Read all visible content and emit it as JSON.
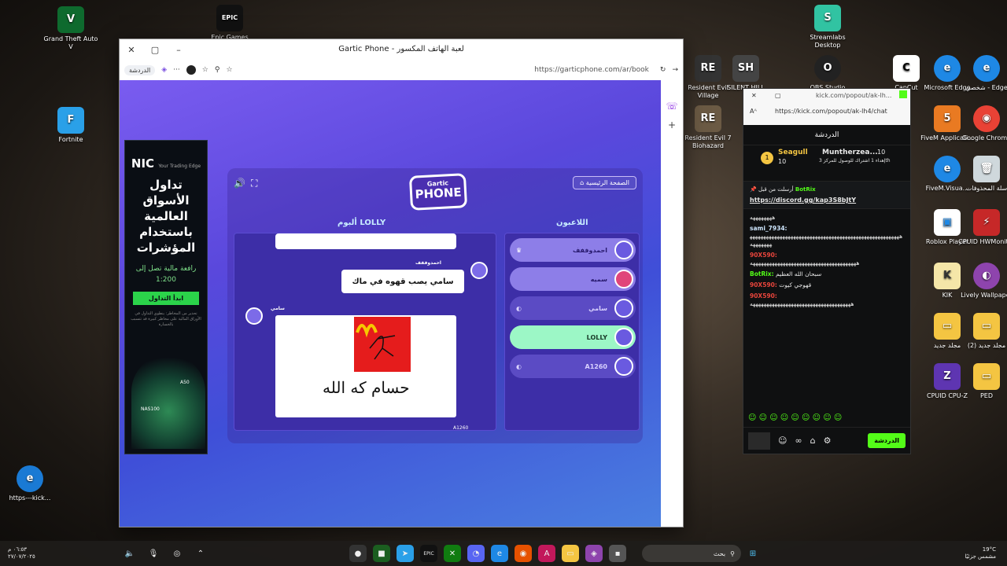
{
  "desktop": {
    "left_icons": [
      {
        "label": "Grand Theft Auto V",
        "glyph": "V"
      },
      {
        "label": "Epic Games",
        "glyph": "EPIC"
      },
      {
        "label": "Fortnite",
        "glyph": "F"
      },
      {
        "label": "https---kick...",
        "glyph": "e"
      }
    ],
    "right_icons": [
      {
        "label": "Streamlabs Desktop",
        "glyph": "S"
      },
      {
        "label": "Resident Evil Village",
        "glyph": "RE"
      },
      {
        "label": "SILENT HILL",
        "glyph": "SH"
      },
      {
        "label": "OBS Studio",
        "glyph": "O"
      },
      {
        "label": "CapCut",
        "glyph": "C"
      },
      {
        "label": "Microsoft Edge",
        "glyph": "e"
      },
      {
        "label": "شخصي - Edge",
        "glyph": "e"
      },
      {
        "label": "Resident Evil 7 Biohazard",
        "glyph": "RE"
      },
      {
        "label": "FiveM Applicati...",
        "glyph": "5"
      },
      {
        "label": "Google Chrome",
        "glyph": "◉"
      },
      {
        "label": "FiveM.Visua...",
        "glyph": "e"
      },
      {
        "label": "سلة المحذوفات",
        "glyph": "🗑"
      },
      {
        "label": "Roblox Player",
        "glyph": "▣"
      },
      {
        "label": "CPUID HWMonitor",
        "glyph": "⚡"
      },
      {
        "label": "KIK",
        "glyph": "K"
      },
      {
        "label": "Lively Wallpaper",
        "glyph": "◐"
      },
      {
        "label": "مجلد جديد",
        "glyph": "▭"
      },
      {
        "label": "(2) مجلد جديد",
        "glyph": "▭"
      },
      {
        "label": "CPUID CPU-Z",
        "glyph": "Z"
      },
      {
        "label": "PED",
        "glyph": "▭"
      }
    ]
  },
  "browser": {
    "title": "Gartic Phone - لعبة الهاتف المكسور",
    "chat_pill": "الدردشة",
    "url": "https://garticphone.com/ar/book"
  },
  "ad": {
    "brand": "NIC",
    "brand_sub": "Your Trading Edge",
    "headline": "تداول الأسواق العالمية باستخدام المؤشرات",
    "sub": "رافعة مالية تصل إلى 1:200",
    "cta": "ابدأ التداول",
    "fine": "تحذير من المخاطر: ينطوي التداول في الأوراق المالية على مخاطر كبيرة قد تتسبب بالخسارة",
    "tag1": "A50",
    "tag2": "NAS100"
  },
  "game": {
    "logo_top": "Gartic",
    "logo_bottom": "PHONE",
    "home": "الصفحة الرئيسية",
    "album_title": "ألبوم LOLLY",
    "players_title": "اللاعبون",
    "players": [
      {
        "name": "احمدوففف"
      },
      {
        "name": "سميه"
      },
      {
        "name": "سامي"
      },
      {
        "name": "LOLLY"
      },
      {
        "name": "A1260"
      }
    ],
    "album": {
      "author1": "احمدوففف",
      "phrase": "سامي يصب قهوه في ماك",
      "author2": "سامي",
      "drawing_text": "حسام كه الله",
      "footer": "A1260"
    }
  },
  "chat": {
    "popout_title": "kick.com/popout/ak-lh...",
    "popout_url": "https://kick.com/popout/ak-lh4/chat",
    "header": "الدردشة",
    "gifter1": "Seagull",
    "gifter1_count": "10",
    "gifter2": "Muntherzea...",
    "gifter2_count": "10",
    "gift_note": "إهداء 1 اشتراك للوصول للمركز 3th",
    "pinned_label": "أرسلت من قبل",
    "pinned_user": "BotRix",
    "pinned_link": "https://discord.gg/kap3S8bJtY",
    "messages": [
      {
        "user": "",
        "text": "ههههههههه"
      },
      {
        "user": "sami_7934:",
        "text": "هههههههههههههههههههههههههههههههههههههههههههههههههههههههههههههههه"
      },
      {
        "user": "90X590:",
        "text": "هههههههههههههههههههههههههههههههههههههههه"
      },
      {
        "user": "BotRix:",
        "text": "سبحان الله العظيم"
      },
      {
        "user": "90X590:",
        "text": "قهوجي كيوت"
      },
      {
        "user": "90X590:",
        "text": "هههههههههههههههههههههههههههههههههههههه"
      }
    ],
    "send": "الدردشة"
  },
  "taskbar": {
    "search": "بحث",
    "weather_temp": "19°C",
    "weather_desc": "مشمس جزئيًا",
    "time": "٠٦:٥٣ م",
    "date": "٢٧/٠٧/٢٠٢٥"
  }
}
